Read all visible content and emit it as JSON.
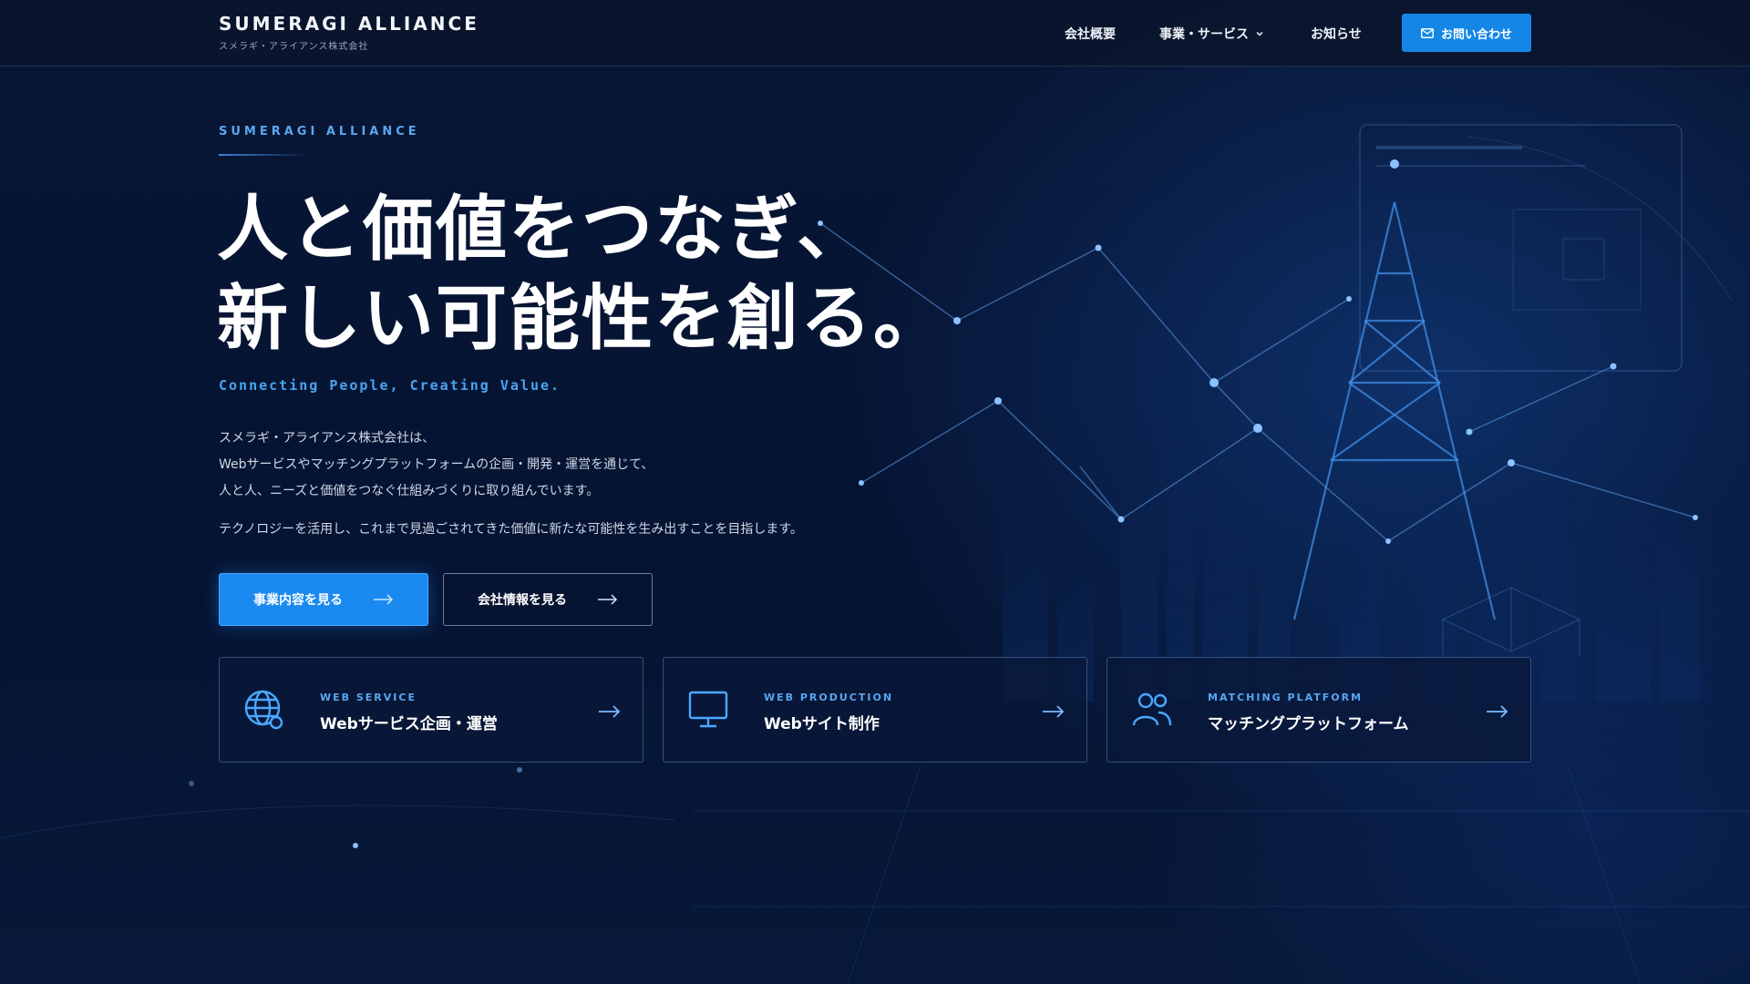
{
  "header": {
    "logo_title": "SUMERAGI ALLIANCE",
    "logo_sub": "スメラギ・アライアンス株式会社",
    "nav": {
      "about": "会社概要",
      "services": "事業・サービス",
      "news": "お知らせ"
    },
    "contact_label": "お問い合わせ"
  },
  "hero": {
    "eyebrow": "SUMERAGI ALLIANCE",
    "headline_line1": "人と価値をつなぎ、",
    "headline_line2": "新しい可能性を創る。",
    "tagline": "Connecting People, Creating Value.",
    "desc_line1": "スメラギ・アライアンス株式会社は、",
    "desc_line2": "Webサービスやマッチングプラットフォームの企画・開発・運営を通じて、",
    "desc_line3": "人と人、ニーズと価値をつなぐ仕組みづくりに取り組んでいます。",
    "desc_line4": "テクノロジーを活用し、これまで見過ごされてきた価値に新たな可能性を生み出すことを目指します。",
    "btn_primary": "事業内容を見る",
    "btn_secondary": "会社情報を見る"
  },
  "cards": [
    {
      "kicker": "WEB SERVICE",
      "title": "Webサービス企画・運営",
      "icon": "globe-icon"
    },
    {
      "kicker": "WEB PRODUCTION",
      "title": "Webサイト制作",
      "icon": "monitor-icon"
    },
    {
      "kicker": "MATCHING PLATFORM",
      "title": "マッチングプラットフォーム",
      "icon": "users-icon"
    }
  ],
  "colors": {
    "background": "#061330",
    "accent": "#1486e6",
    "accent_text": "#5aa7f0"
  }
}
